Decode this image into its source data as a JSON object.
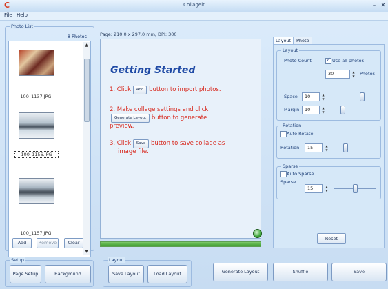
{
  "window": {
    "app_icon": "C",
    "title": "Collageit",
    "minimize_glyph": "–",
    "close_glyph": "✕"
  },
  "menu": {
    "items": [
      "File",
      "Help"
    ]
  },
  "photo_list": {
    "group_title": "Photo List",
    "count_label": "8 Photos",
    "photos": [
      {
        "filename": "100_1137.JPG",
        "selected": false
      },
      {
        "filename": "100_1156.JPG",
        "selected": true
      },
      {
        "filename": "100_1157.JPG",
        "selected": false
      }
    ],
    "buttons": {
      "add": "Add",
      "remove": "Remove",
      "clear": "Clear"
    }
  },
  "preview": {
    "page_info": "Page: 210.0 x 297.0 mm, DPI: 300",
    "heading": "Getting Started",
    "step1": {
      "before": "1. Click",
      "button": "Add",
      "after": "button to import photos."
    },
    "step2": {
      "line1": "2. Make collage settings and click",
      "button": "Generate Layout",
      "after": "button to generate",
      "line3": "preview."
    },
    "step3": {
      "before": "3. Click",
      "button": "Save",
      "after": "button to save collage as",
      "line2": "image file."
    },
    "progress_fraction": 1.0
  },
  "settings": {
    "tabs": [
      "Layout",
      "Photo"
    ],
    "active_tab": "Layout",
    "layout_group": {
      "title": "Layout",
      "photo_count_label": "Photo Count",
      "use_all_photos_label": "Use all photos",
      "use_all_photos_checked": true,
      "photos_value": "30",
      "photos_unit": "Photos",
      "space_label": "Space",
      "space_value": "10",
      "margin_label": "Margin",
      "margin_value": "10"
    },
    "rotation_group": {
      "title": "Rotation",
      "auto_rotate_label": "Auto Rotate",
      "auto_rotate_checked": false,
      "rotation_label": "Rotation",
      "rotation_value": "15"
    },
    "sparse_group": {
      "title": "Sparse",
      "auto_sparse_label": "Auto Sparse",
      "auto_sparse_checked": false,
      "sparse_label": "Sparse",
      "sparse_value": "15"
    },
    "reset_label": "Reset"
  },
  "bottom_bar": {
    "setup_group_title": "Setup",
    "page_setup": "Page Setup",
    "background": "Background",
    "layout_group_title": "Layout",
    "save_layout": "Save Layout",
    "load_layout": "Load Layout",
    "generate_layout": "Generate Layout",
    "shuffle": "Shuffle",
    "save": "Save"
  }
}
